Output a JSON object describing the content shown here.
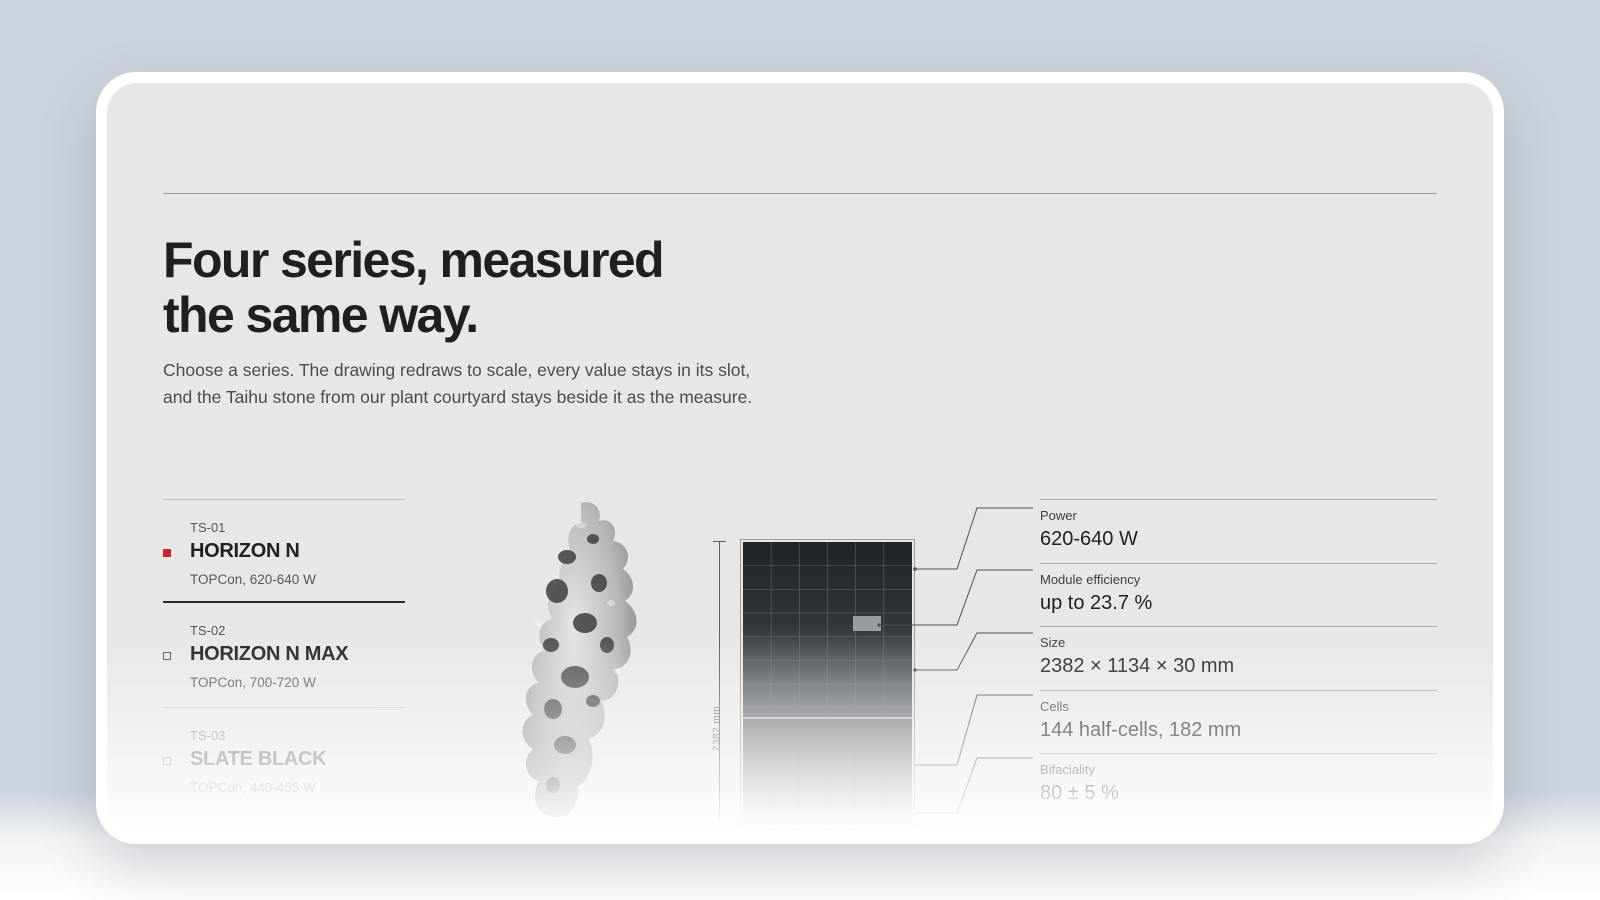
{
  "headline": {
    "line1": "Four series, measured",
    "line2": "the same way."
  },
  "lede": "Choose a series. The drawing redraws to scale, every value stays in its slot, and the Taihu stone from our plant courtyard stays beside it as the measure.",
  "series": [
    {
      "code": "TS-01",
      "name": "HORIZON N",
      "desc": "TOPCon, 620-640 W",
      "selected": true
    },
    {
      "code": "TS-02",
      "name": "HORIZON N MAX",
      "desc": "TOPCon, 700-720 W",
      "selected": false
    },
    {
      "code": "TS-03",
      "name": "SLATE BLACK",
      "desc": "TOPCon, 440-455 W",
      "selected": false
    }
  ],
  "drawing": {
    "dimension_label": "2382 mm"
  },
  "specs": [
    {
      "label": "Power",
      "value": "620-640 W"
    },
    {
      "label": "Module efficiency",
      "value": "up to 23.7 %"
    },
    {
      "label": "Size",
      "value": "2382 × 1134 × 30 mm"
    },
    {
      "label": "Cells",
      "value": "144 half-cells, 182 mm"
    },
    {
      "label": "Bifaciality",
      "value": "80 ± 5 %"
    }
  ],
  "colors": {
    "accent": "#c62828",
    "text": "#1e2022",
    "background": "#e8e7e5",
    "panel_frame": "#2b2f33"
  }
}
